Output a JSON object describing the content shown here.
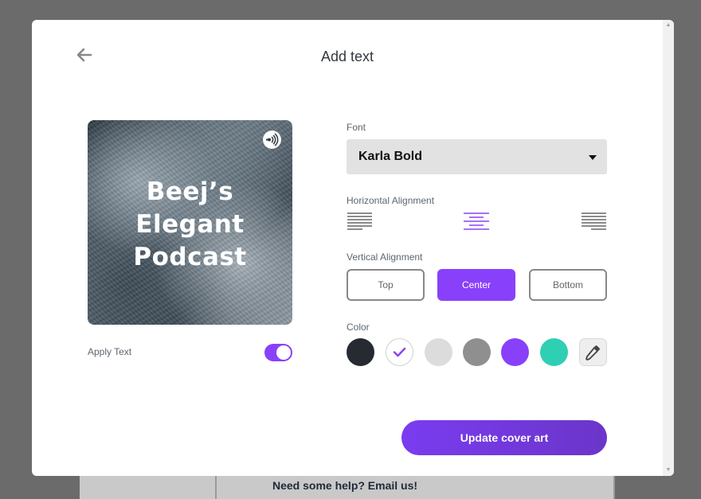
{
  "modal": {
    "title": "Add text"
  },
  "cover": {
    "title_lines": [
      "Beej’s",
      "Elegant",
      "Podcast"
    ]
  },
  "apply_text": {
    "label": "Apply Text",
    "enabled": true
  },
  "font": {
    "label": "Font",
    "selected": "Karla Bold"
  },
  "horizontal_alignment": {
    "label": "Horizontal Alignment",
    "options": [
      "left",
      "center",
      "right"
    ],
    "selected": "center"
  },
  "vertical_alignment": {
    "label": "Vertical Alignment",
    "options": [
      "Top",
      "Center",
      "Bottom"
    ],
    "selected": "Center"
  },
  "color": {
    "label": "Color",
    "swatches": [
      "#262b31",
      "#ffffff",
      "#dcdcdc",
      "#8f8f8f",
      "#8940fa",
      "#2fcfb4"
    ],
    "selected_index": 1
  },
  "update_button": {
    "label": "Update cover art"
  },
  "background": {
    "help_text": "Need some help? Email us!"
  },
  "accent_color": "#8940fa"
}
